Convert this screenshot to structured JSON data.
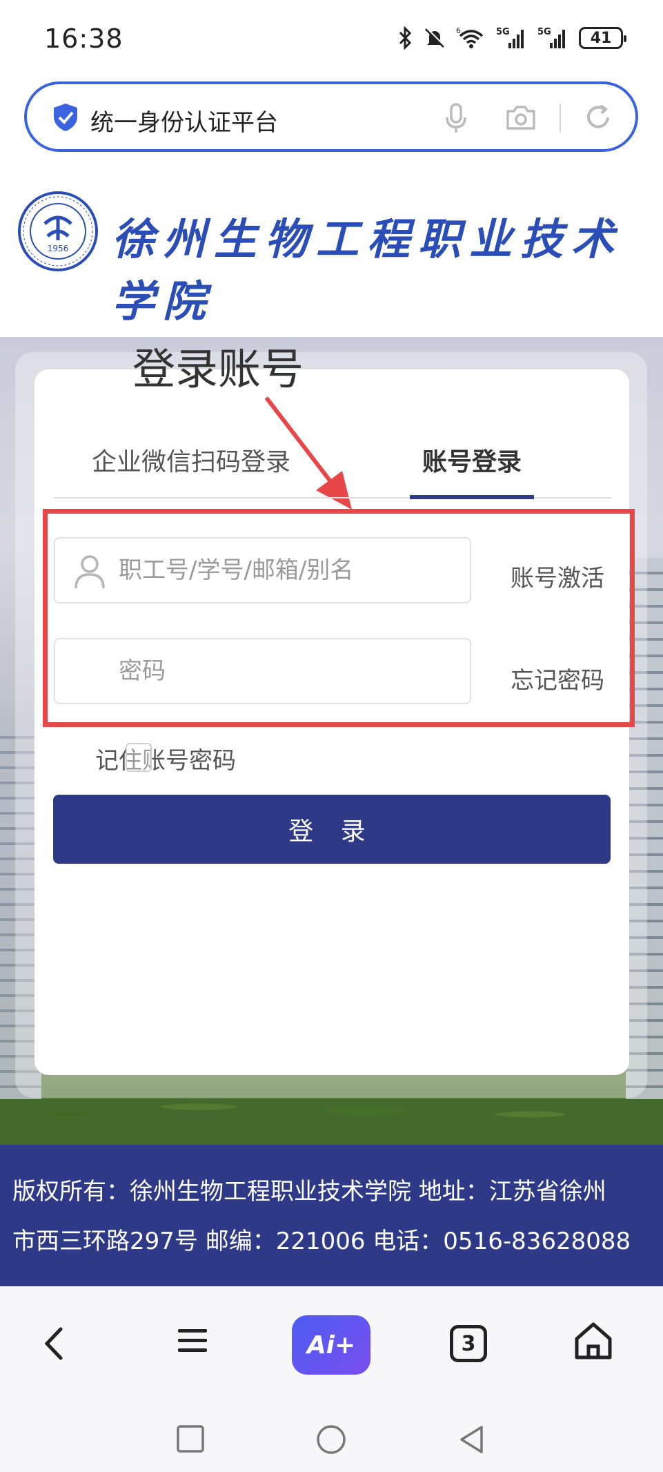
{
  "status_bar": {
    "time": "16:38",
    "battery": "41",
    "icons": [
      "bluetooth-icon",
      "bell-off-icon",
      "wifi-icon",
      "signal-5g-icon",
      "signal-5g-icon"
    ]
  },
  "address_bar": {
    "title": "统一身份认证平台",
    "icons": [
      "shield-icon",
      "microphone-icon",
      "camera-icon",
      "refresh-icon"
    ]
  },
  "school": {
    "name": "徐州生物工程职业技术学院",
    "logo_year": "1956"
  },
  "annotation": {
    "title": "登录账号",
    "box_color": "#e8474a"
  },
  "login": {
    "tabs": [
      {
        "label": "企业微信扫码登录",
        "active": false
      },
      {
        "label": "账号登录",
        "active": true
      }
    ],
    "username_placeholder": "职工号/学号/邮箱/别名",
    "password_placeholder": "密码",
    "activate_link": "账号激活",
    "forgot_link": "忘记密码",
    "remember_label": "记住账号密码",
    "submit_label": "登 录"
  },
  "footer": {
    "line1": "版权所有：徐州生物工程职业技术学院 地址：江苏省徐州",
    "line2": "市西三环路297号 邮编：221006 电话：0516-83628088"
  },
  "toolbar": {
    "ai_label": "Ai+",
    "tab_count": "3"
  },
  "colors": {
    "primary": "#2e3a87",
    "accent": "#3b63e0",
    "highlight": "#e8474a"
  }
}
